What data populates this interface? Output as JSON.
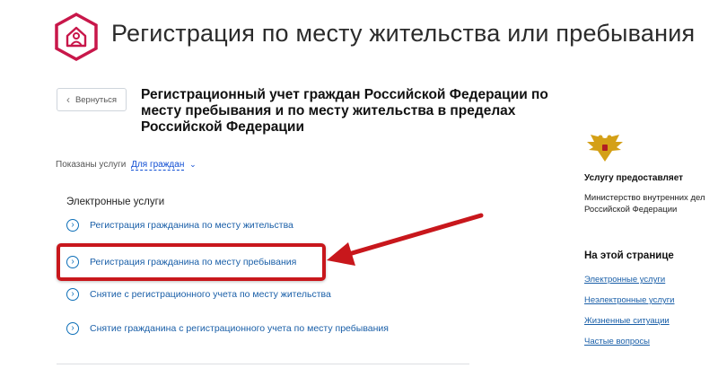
{
  "header": {
    "title": "Регистрация по месту жительства или пребывания",
    "logo_icon": "house-person-icon",
    "brand_color": "#c8174a"
  },
  "back_button": {
    "label": "Вернуться",
    "icon": "chevron-left-icon"
  },
  "subtitle": "Регистрационный учет граждан Российской Федерации по месту пребывания и по месту жительства в пределах Российской Федерации",
  "filter": {
    "label": "Показаны услуги",
    "value": "Для граждан",
    "icon": "chevron-down-icon"
  },
  "electronic_services": {
    "title": "Электронные услуги",
    "items": [
      {
        "label": "Регистрация гражданина по месту жительства"
      },
      {
        "label": "Регистрация гражданина по месту пребывания"
      },
      {
        "label": "Снятие с регистрационного учета по месту жительства"
      },
      {
        "label": "Снятие гражданина с регистрационного учета по месту пребывания"
      }
    ]
  },
  "annotation": {
    "highlight_color": "#c8171c",
    "highlighted_item": "Регистрация гражданина по месту пребывания"
  },
  "sidebar": {
    "emblem_icon": "eagle-emblem-icon",
    "provider_heading": "Услугу предоставляет",
    "provider_name": "Министерство внутренних дел Российской Федерации",
    "on_page_heading": "На этой странице",
    "on_page_links": [
      {
        "label": "Электронные услуги"
      },
      {
        "label": "Неэлектронные услуги"
      },
      {
        "label": "Жизненные ситуации"
      },
      {
        "label": "Частые вопросы"
      }
    ]
  },
  "colors": {
    "link": "#1a5fa8",
    "accent_blue": "#0d6fb8"
  }
}
